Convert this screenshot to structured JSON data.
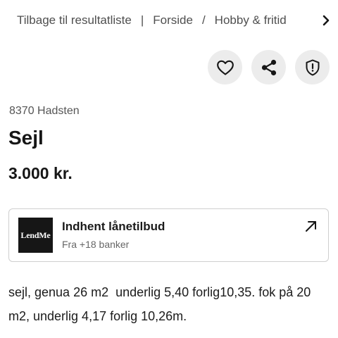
{
  "breadcrumb": {
    "back_label": "Tilbage til resultatliste",
    "separator_1": "|",
    "home_label": "Forside",
    "separator_2": "/",
    "category_label": "Hobby & fritid"
  },
  "actions": {
    "favorite_icon": "heart-icon",
    "share_icon": "share-icon",
    "report_icon": "shield-alert-icon"
  },
  "listing": {
    "location": "8370 Hadsten",
    "title": "Sejl",
    "price": "3.000 kr.",
    "description": "sejl, genua 26 m2  underlig 5,40 forlig10,35. fok på 20 m2, underlig 4,17 forlig 10,26m."
  },
  "loan_offer": {
    "logo_text": "LendMe",
    "title": "Indhent lånetilbud",
    "subtitle": "Fra +18 banker"
  },
  "colors": {
    "icon_button_bg": "#ececec",
    "logo_bg": "#161616",
    "card_border": "#cfcfcf"
  }
}
